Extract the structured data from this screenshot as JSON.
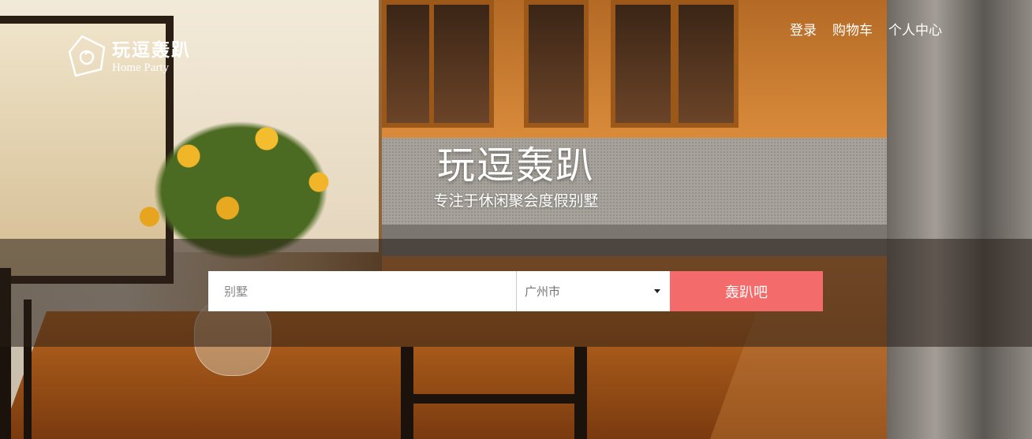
{
  "brand": {
    "name_cn": "玩逗轰趴",
    "name_en": "Home Party"
  },
  "nav": {
    "items": [
      {
        "label": "登录"
      },
      {
        "label": "购物车"
      },
      {
        "label": "个人中心"
      }
    ]
  },
  "hero": {
    "title": "玩逗轰趴",
    "subtitle": "专注于休闲聚会度假别墅"
  },
  "search": {
    "placeholder": "别墅",
    "city_selected": "广州市",
    "submit_label": "轰趴吧"
  },
  "colors": {
    "accent": "#f36b6b",
    "overlay": "#281e18"
  },
  "icons": {
    "logo": "house-icon",
    "dropdown": "chevron-down-icon"
  }
}
